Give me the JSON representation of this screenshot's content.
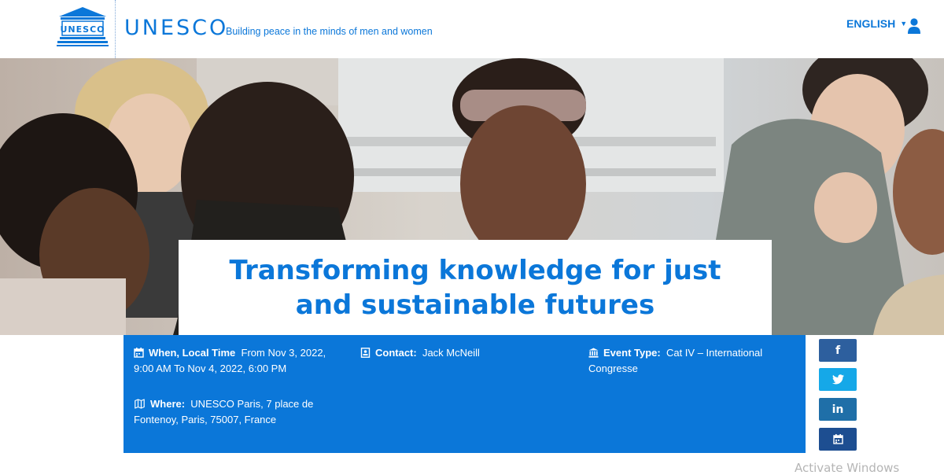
{
  "header": {
    "logo_emblem_text": "UNESCO",
    "logo_word": "UNESCO",
    "tagline": "Building peace in the minds of men and women",
    "language": "ENGLISH",
    "language_caret_icon": "caret-down-icon",
    "user_icon": "user-icon"
  },
  "hero": {
    "title": "Transforming knowledge for just and sustainable futures"
  },
  "event_info": {
    "when_label": "When, Local Time",
    "when_value": "From  Nov 3, 2022, 9:00 AM  To  Nov 4, 2022, 6:00 PM",
    "contact_label": "Contact:",
    "contact_value": "Jack McNeill",
    "event_type_label": "Event Type:",
    "event_type_value": "Cat IV – International Congresse",
    "where_label": "Where:",
    "where_value": "UNESCO Paris,  7 place de Fontenoy,  Paris,  75007,  France",
    "icons": {
      "when": "calendar-icon",
      "contact": "contact-card-icon",
      "event_type": "institution-icon",
      "where": "map-icon"
    }
  },
  "share": {
    "facebook_label": "f",
    "twitter_icon": "twitter-icon",
    "linkedin_label": "in",
    "calendar_icon": "calendar-icon"
  },
  "watermark": "Activate Windows",
  "colors": {
    "brand_blue": "#0b77d9",
    "facebook": "#2d5f9e",
    "twitter": "#15a8e8",
    "linkedin": "#1f6fa8",
    "calendar_button": "#1d4e91"
  }
}
